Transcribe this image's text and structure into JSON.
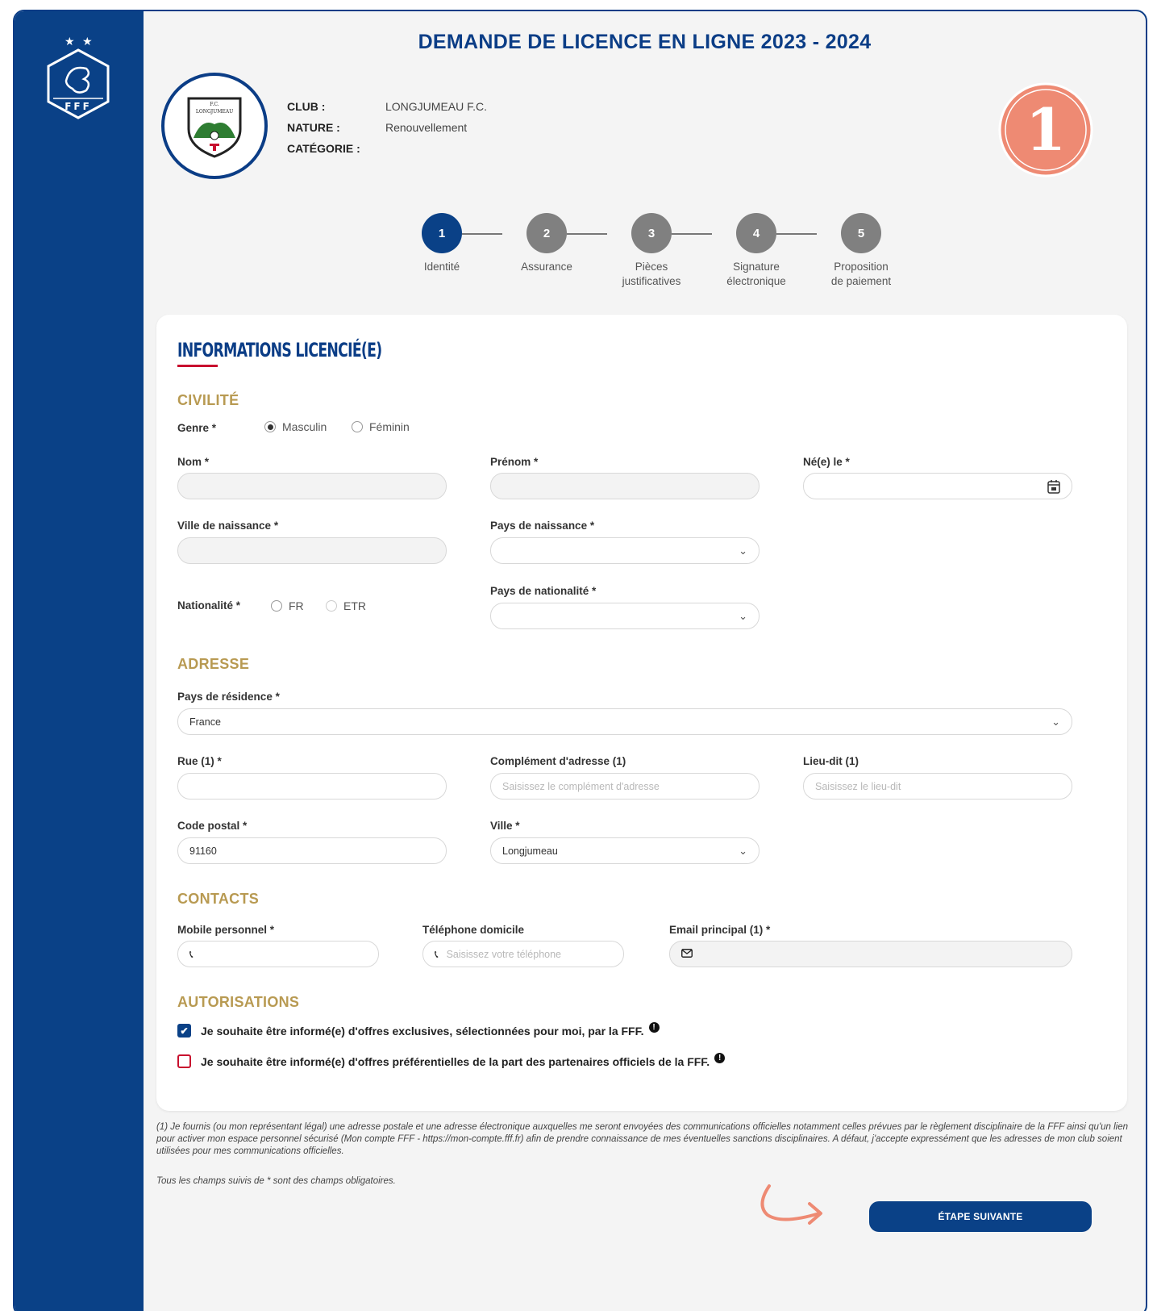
{
  "header": {
    "title": "DEMANDE DE LICENCE EN LIGNE 2023 - 2024"
  },
  "sidebar": {
    "logo_text": "FFF"
  },
  "club_badge": {
    "top_text": "F.C.",
    "name_text": "LONGJUMEAU"
  },
  "club": {
    "club_label": "CLUB :",
    "club_value": "LONGJUMEAU F.C.",
    "nature_label": "NATURE :",
    "nature_value": "Renouvellement",
    "categorie_label": "CATÉGORIE :",
    "categorie_value": ""
  },
  "step_badge": {
    "number": "1"
  },
  "stepper": {
    "steps": [
      {
        "number": "1",
        "label": "Identité",
        "label2": ""
      },
      {
        "number": "2",
        "label": "Assurance",
        "label2": ""
      },
      {
        "number": "3",
        "label": "Pièces",
        "label2": "justificatives"
      },
      {
        "number": "4",
        "label": "Signature",
        "label2": "électronique"
      },
      {
        "number": "5",
        "label": "Proposition",
        "label2": "de paiement"
      }
    ]
  },
  "form": {
    "title": "INFORMATIONS LICENCIÉ(E)",
    "civilite": {
      "heading": "CIVILITÉ",
      "genre_label": "Genre *",
      "masculin": "Masculin",
      "feminin": "Féminin",
      "nom_label": "Nom *",
      "prenom_label": "Prénom *",
      "ne_le_label": "Né(e) le *",
      "ville_naissance_label": "Ville de naissance *",
      "pays_naissance_label": "Pays de naissance *",
      "nationalite_label": "Nationalité *",
      "fr": "FR",
      "etr": "ETR",
      "pays_nationalite_label": "Pays de nationalité *"
    },
    "adresse": {
      "heading": "ADRESSE",
      "pays_residence_label": "Pays de résidence *",
      "pays_residence_value": "France",
      "rue_label": "Rue (1) *",
      "complement_label": "Complément d'adresse (1)",
      "complement_placeholder": "Saisissez le complément d'adresse",
      "lieu_dit_label": "Lieu-dit (1)",
      "lieu_dit_placeholder": "Saisissez le lieu-dit",
      "code_postal_label": "Code postal *",
      "code_postal_value": "91160",
      "ville_label": "Ville *",
      "ville_value": "Longjumeau"
    },
    "contacts": {
      "heading": "CONTACTS",
      "mobile_label": "Mobile personnel *",
      "telephone_label": "Téléphone domicile",
      "telephone_placeholder": "Saisissez votre téléphone",
      "email_label": "Email principal (1) *"
    },
    "autorisations": {
      "heading": "AUTORISATIONS",
      "offre_fff": "Je souhaite être informé(e) d'offres exclusives, sélectionnées pour moi, par la FFF.",
      "offre_partenaires": "Je souhaite être informé(e) d'offres préférentielles de la part des partenaires officiels de la FFF."
    }
  },
  "footer": {
    "note1": "(1) Je fournis (ou mon représentant légal) une adresse postale et une adresse électronique auxquelles me seront envoyées des communications officielles notamment celles prévues par le règlement disciplinaire de la FFF ainsi qu'un lien pour activer mon espace personnel sécurisé (Mon compte FFF - https://mon-compte.fff.fr) afin de prendre connaissance de mes éventuelles sanctions disciplinaires. A défaut, j'accepte expressément que les adresses de mon club soient utilisées pour mes communications officielles.",
    "note2": "Tous les champs suivis de * sont des champs obligatoires.",
    "next_button": "ÉTAPE SUIVANTE"
  },
  "colors": {
    "primary": "#0a4187",
    "accent": "#c8102e",
    "section": "#b89a52",
    "badge": "#ee8a73"
  }
}
